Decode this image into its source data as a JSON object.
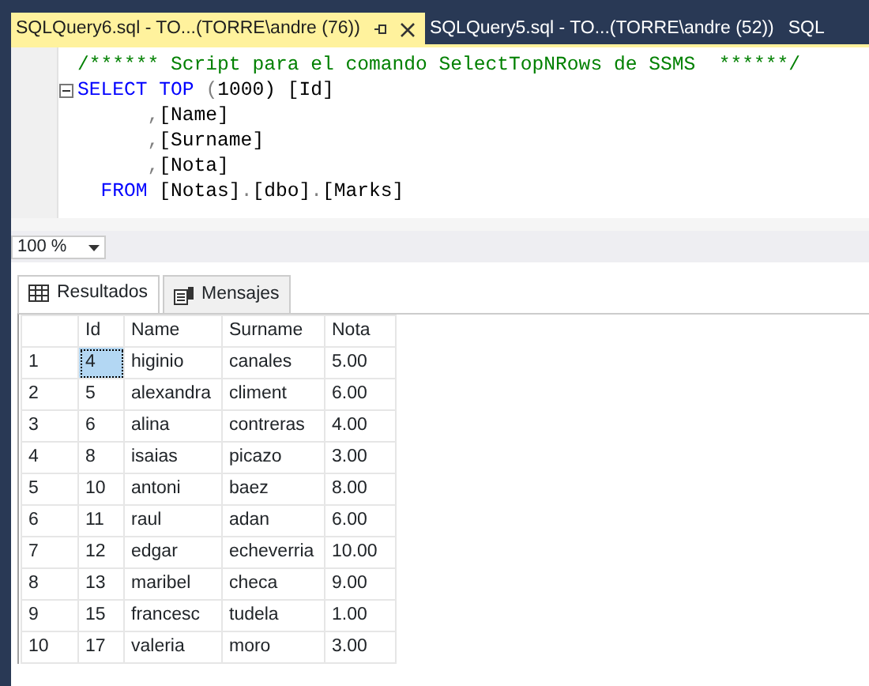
{
  "document_tabs": [
    {
      "label": "SQLQuery6.sql - TO...(TORRE\\andre (76))",
      "selected": true
    },
    {
      "label": "SQLQuery5.sql - TO...(TORRE\\andre (52))",
      "selected": false
    },
    {
      "label": "SQL",
      "selected": false
    }
  ],
  "editor": {
    "lines": [
      {
        "foldable": false,
        "tokens": [
          {
            "text": "/****** Script para el comando SelectTopNRows de SSMS  ******/",
            "kind": "comment"
          }
        ]
      },
      {
        "foldable": true,
        "tokens": [
          {
            "text": "SELECT",
            "kind": "keyword"
          },
          {
            "text": " TOP",
            "kind": "keyword"
          },
          {
            "text": " (",
            "kind": "punct"
          },
          {
            "text": "1000",
            "kind": "plain"
          },
          {
            "text": ") [Id]",
            "kind": "plain"
          }
        ]
      },
      {
        "foldable": false,
        "tokens": [
          {
            "text": "      ,",
            "kind": "punct"
          },
          {
            "text": "[Name]",
            "kind": "plain"
          }
        ]
      },
      {
        "foldable": false,
        "tokens": [
          {
            "text": "      ,",
            "kind": "punct"
          },
          {
            "text": "[Surname]",
            "kind": "plain"
          }
        ]
      },
      {
        "foldable": false,
        "tokens": [
          {
            "text": "      ,",
            "kind": "punct"
          },
          {
            "text": "[Nota]",
            "kind": "plain"
          }
        ]
      },
      {
        "foldable": false,
        "tokens": [
          {
            "text": "  FROM",
            "kind": "keyword"
          },
          {
            "text": " [Notas]",
            "kind": "plain"
          },
          {
            "text": ".",
            "kind": "punct"
          },
          {
            "text": "[dbo]",
            "kind": "plain"
          },
          {
            "text": ".",
            "kind": "punct"
          },
          {
            "text": "[Marks]",
            "kind": "plain"
          }
        ]
      }
    ]
  },
  "zoom": {
    "value": "100 %"
  },
  "result_tabs": [
    {
      "label": "Resultados",
      "selected": true
    },
    {
      "label": "Mensajes",
      "selected": false
    }
  ],
  "table": {
    "columns": [
      "Id",
      "Name",
      "Surname",
      "Nota"
    ],
    "rows": [
      {
        "number": "1",
        "cells": [
          {
            "text": "4",
            "selected": true
          },
          {
            "text": "higinio",
            "selected": false
          },
          {
            "text": "canales",
            "selected": false
          },
          {
            "text": "5.00",
            "selected": false
          }
        ]
      },
      {
        "number": "2",
        "cells": [
          {
            "text": "5",
            "selected": false
          },
          {
            "text": "alexandra",
            "selected": false
          },
          {
            "text": "climent",
            "selected": false
          },
          {
            "text": "6.00",
            "selected": false
          }
        ]
      },
      {
        "number": "3",
        "cells": [
          {
            "text": "6",
            "selected": false
          },
          {
            "text": "alina",
            "selected": false
          },
          {
            "text": "contreras",
            "selected": false
          },
          {
            "text": "4.00",
            "selected": false
          }
        ]
      },
      {
        "number": "4",
        "cells": [
          {
            "text": "8",
            "selected": false
          },
          {
            "text": "isaias",
            "selected": false
          },
          {
            "text": "picazo",
            "selected": false
          },
          {
            "text": "3.00",
            "selected": false
          }
        ]
      },
      {
        "number": "5",
        "cells": [
          {
            "text": "10",
            "selected": false
          },
          {
            "text": "antoni",
            "selected": false
          },
          {
            "text": "baez",
            "selected": false
          },
          {
            "text": "8.00",
            "selected": false
          }
        ]
      },
      {
        "number": "6",
        "cells": [
          {
            "text": "11",
            "selected": false
          },
          {
            "text": "raul",
            "selected": false
          },
          {
            "text": "adan",
            "selected": false
          },
          {
            "text": "6.00",
            "selected": false
          }
        ]
      },
      {
        "number": "7",
        "cells": [
          {
            "text": "12",
            "selected": false
          },
          {
            "text": "edgar",
            "selected": false
          },
          {
            "text": "echeverria",
            "selected": false
          },
          {
            "text": "10.00",
            "selected": false
          }
        ]
      },
      {
        "number": "8",
        "cells": [
          {
            "text": "13",
            "selected": false
          },
          {
            "text": "maribel",
            "selected": false
          },
          {
            "text": "checa",
            "selected": false
          },
          {
            "text": "9.00",
            "selected": false
          }
        ]
      },
      {
        "number": "9",
        "cells": [
          {
            "text": "15",
            "selected": false
          },
          {
            "text": "francesc",
            "selected": false
          },
          {
            "text": "tudela",
            "selected": false
          },
          {
            "text": "1.00",
            "selected": false
          }
        ]
      },
      {
        "number": "10",
        "cells": [
          {
            "text": "17",
            "selected": false
          },
          {
            "text": "valeria",
            "selected": false
          },
          {
            "text": "moro",
            "selected": false
          },
          {
            "text": "3.00",
            "selected": false
          }
        ]
      }
    ]
  }
}
